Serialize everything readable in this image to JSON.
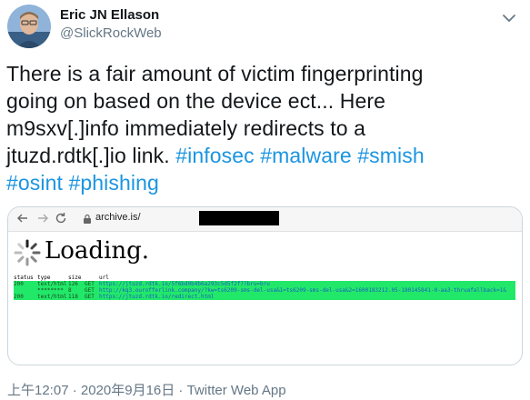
{
  "author": {
    "name": "Eric JN Ellason",
    "handle": "@SlickRockWeb"
  },
  "tweet": {
    "line1": "There is a fair amount of victim fingerprinting",
    "line2": "going on based on the device ect...  Here",
    "line3": "m9sxv[.]info immediately redirects to a",
    "line4_text": "jtuzd.rdtk[.]io link. ",
    "hashtags": [
      "#infosec",
      "#malware",
      "#smish",
      "#osint",
      "#phishing"
    ]
  },
  "media": {
    "url": "archive.is/",
    "loading": "Loading.",
    "log_headers": [
      "status",
      "type",
      "size",
      "",
      "url"
    ],
    "log_rows": [
      {
        "status": "200",
        "type": "text/html",
        "size": "126",
        "method": "GET",
        "url": "https://jtuzd.rdtk.io/5f6bd0b4b6a293c5d5f2f7?bru=bru"
      },
      {
        "status": "",
        "type": "********",
        "size": "8",
        "method": "GET",
        "url": "http://kq3.ourofferlink.company/?kw=ts6209-sms-del-usa&1=ts6209-sms-del-usa&2=1600183212.05-180145841-0-aa3-thruafallback=1&"
      },
      {
        "status": "200",
        "type": "text/html",
        "size": "118",
        "method": "GET",
        "url": "https://jtuzd.rdtk.io/redirect.html"
      }
    ]
  },
  "footer": {
    "timestamp": "上午12:07 · 2020年9月16日 · Twitter Web App"
  },
  "colors": {
    "link": "#1b95e0",
    "highlight": "#22e86a",
    "muted": "#657786"
  }
}
